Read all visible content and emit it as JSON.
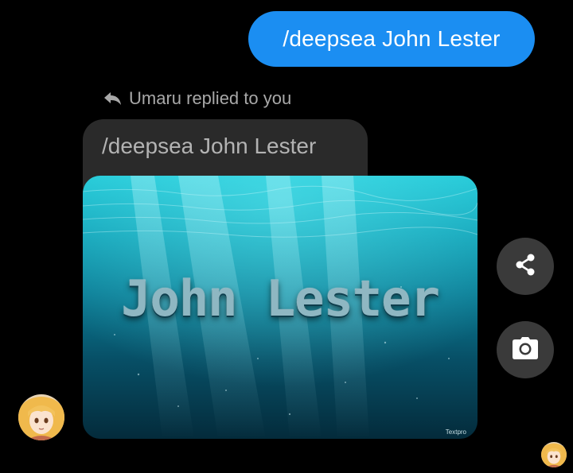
{
  "sent_message": {
    "text": "/deepsea John Lester"
  },
  "reply": {
    "header": "Umaru replied to you",
    "quoted_text": "/deepsea John Lester",
    "image_title": "John Lester",
    "image_watermark": "Textpro"
  },
  "actions": {
    "share_icon": "share-icon",
    "camera_icon": "camera-icon"
  },
  "colors": {
    "sent_bubble": "#1b8ef2",
    "quoted_bubble": "#2a2a2a",
    "fab_background": "#3a3a3a",
    "background": "#000000"
  }
}
